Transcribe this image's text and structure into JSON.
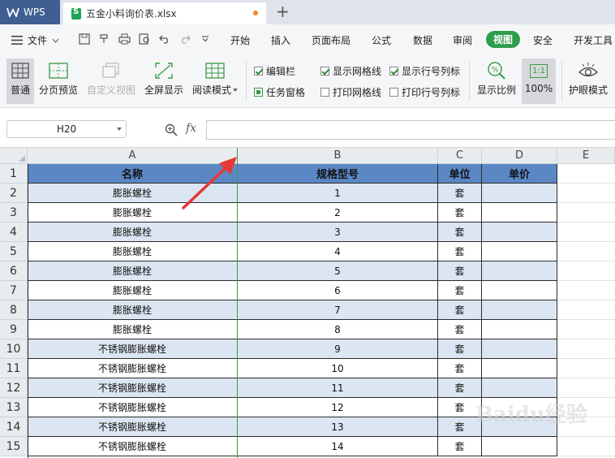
{
  "app": {
    "name": "WPS"
  },
  "tab": {
    "filename": "五金小料询价表.xlsx"
  },
  "menu": {
    "file_label": "文件",
    "items": [
      "开始",
      "插入",
      "页面布局",
      "公式",
      "数据",
      "审阅",
      "视图",
      "安全",
      "开发工具"
    ],
    "active": "视图"
  },
  "ribbon": {
    "normal": "普通",
    "page_break": "分页预览",
    "custom_view": "自定义视图",
    "fullscreen": "全屏显示",
    "reading_mode": "阅读模式",
    "checks": {
      "formula_bar": "编辑栏",
      "show_gridlines": "显示网格线",
      "show_headers": "显示行号列标",
      "task_pane": "任务窗格",
      "print_gridlines": "打印网格线",
      "print_headers": "打印行号列标"
    },
    "zoom_label": "显示比例",
    "zoom_100": "100%",
    "zoom_icon_text": "1:1",
    "eye_mode": "护眼模式"
  },
  "formula": {
    "cell_ref": "H20",
    "fx": "fx"
  },
  "grid": {
    "columns": [
      "A",
      "B",
      "C",
      "D",
      "E"
    ],
    "header_row": [
      "名称",
      "规格型号",
      "单位",
      "单价"
    ],
    "rows": [
      [
        "膨胀螺栓",
        "1",
        "套",
        ""
      ],
      [
        "膨胀螺栓",
        "2",
        "套",
        ""
      ],
      [
        "膨胀螺栓",
        "3",
        "套",
        ""
      ],
      [
        "膨胀螺栓",
        "4",
        "套",
        ""
      ],
      [
        "膨胀螺栓",
        "5",
        "套",
        ""
      ],
      [
        "膨胀螺栓",
        "6",
        "套",
        ""
      ],
      [
        "膨胀螺栓",
        "7",
        "套",
        ""
      ],
      [
        "膨胀螺栓",
        "8",
        "套",
        ""
      ],
      [
        "不锈钢膨胀螺栓",
        "9",
        "套",
        ""
      ],
      [
        "不锈钢膨胀螺栓",
        "10",
        "套",
        ""
      ],
      [
        "不锈钢膨胀螺栓",
        "11",
        "套",
        ""
      ],
      [
        "不锈钢膨胀螺栓",
        "12",
        "套",
        ""
      ],
      [
        "不锈钢膨胀螺栓",
        "13",
        "套",
        ""
      ],
      [
        "不锈钢膨胀螺栓",
        "14",
        "套",
        ""
      ]
    ],
    "row_numbers": [
      "1",
      "2",
      "3",
      "4",
      "5",
      "6",
      "7",
      "8",
      "9",
      "10",
      "11",
      "12",
      "13",
      "14",
      "15"
    ]
  },
  "colors": {
    "header_blue": "#5b87c5",
    "band_blue": "#dce6f2",
    "active_green": "#2e9e4a",
    "arrow_red": "#e53935"
  },
  "watermark": {
    "text": "Baidu经验"
  }
}
